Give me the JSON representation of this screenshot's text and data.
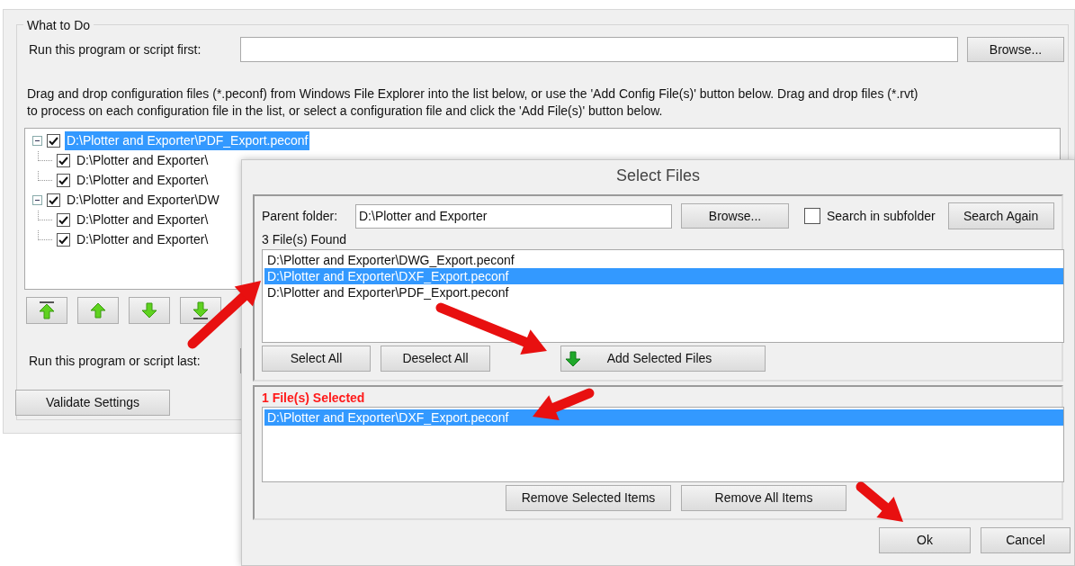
{
  "main": {
    "group_title": "What to Do",
    "run_first_label": "Run this program or script first:",
    "browse_button": "Browse...",
    "instructions": "Drag and drop configuration files (*.peconf) from Windows File Explorer into the list below, or use the 'Add Config File(s)' button below.  Drag and drop files (*.rvt)\nto process on each configuration file in the list, or select a configuration file and click the 'Add File(s)' button below.",
    "tree": [
      {
        "text": "D:\\Plotter and Exporter\\PDF_Export.peconf",
        "checked": true,
        "selected": true,
        "expanded": true,
        "children": [
          {
            "text": "D:\\Plotter and Exporter\\",
            "checked": true,
            "selected": false
          },
          {
            "text": "D:\\Plotter and Exporter\\",
            "checked": true,
            "selected": false
          }
        ]
      },
      {
        "text": "D:\\Plotter and Exporter\\DW",
        "checked": true,
        "selected": false,
        "expanded": true,
        "children": [
          {
            "text": "D:\\Plotter and Exporter\\",
            "checked": true,
            "selected": false
          },
          {
            "text": "D:\\Plotter and Exporter\\",
            "checked": true,
            "selected": false
          }
        ]
      }
    ],
    "move_buttons": [
      {
        "kind": "top"
      },
      {
        "kind": "up"
      },
      {
        "kind": "down"
      },
      {
        "kind": "bottom"
      }
    ],
    "run_last_label": "Run this program or script last:",
    "validate_button": "Validate Settings"
  },
  "dialog": {
    "title": "Select Files",
    "parent_folder_label": "Parent folder:",
    "parent_folder_value": "D:\\Plotter and Exporter",
    "browse_button": "Browse...",
    "search_subfolder": {
      "label": "Search  in subfolder",
      "checked": false
    },
    "search_again_button": "Search Again",
    "found_label": "3 File(s) Found",
    "found_files": [
      {
        "text": "D:\\Plotter and Exporter\\DWG_Export.peconf",
        "selected": false
      },
      {
        "text": "D:\\Plotter and Exporter\\DXF_Export.peconf",
        "selected": true
      },
      {
        "text": "D:\\Plotter and Exporter\\PDF_Export.peconf",
        "selected": false
      }
    ],
    "select_all_button": "Select All",
    "deselect_all_button": "Deselect All",
    "add_selected_button": "Add Selected Files",
    "selected_label": "1 File(s) Selected",
    "selected_files": [
      {
        "text": "D:\\Plotter and Exporter\\DXF_Export.peconf",
        "selected": true
      }
    ],
    "remove_selected_button": "Remove Selected Items",
    "remove_all_button": "Remove All Items",
    "ok_button": "Ok",
    "cancel_button": "Cancel"
  }
}
